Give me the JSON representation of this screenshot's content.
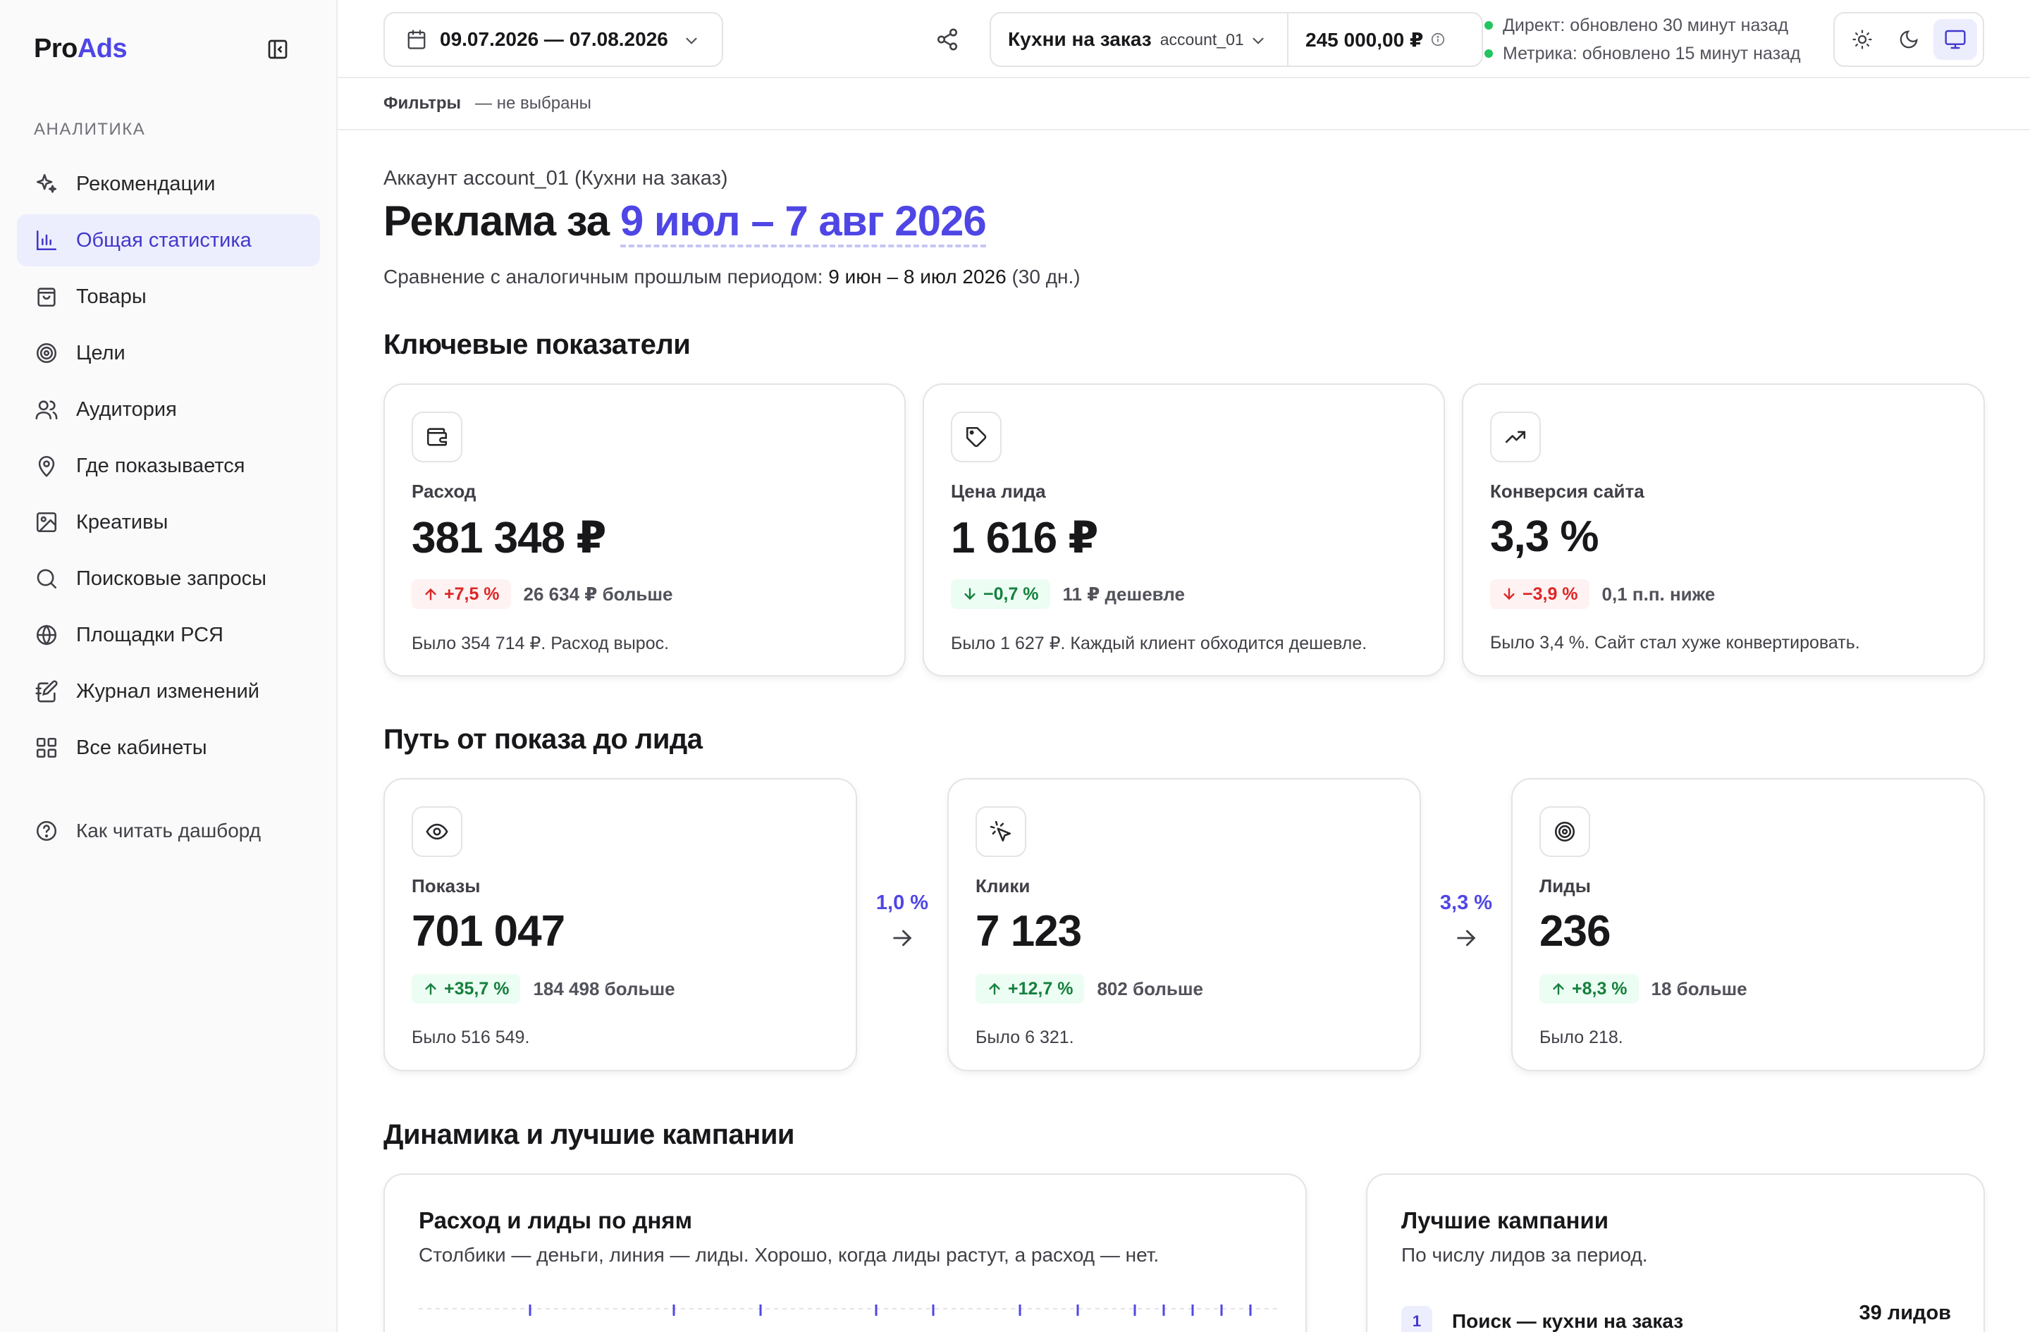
{
  "brand": {
    "pro": "Pro",
    "ads": "Ads"
  },
  "sidebar": {
    "section": "АНАЛИТИКА",
    "items": [
      {
        "label": "Рекомендации",
        "icon": "sparkles-icon"
      },
      {
        "label": "Общая статистика",
        "icon": "bar-chart-icon",
        "active": true
      },
      {
        "label": "Товары",
        "icon": "shopping-bag-icon"
      },
      {
        "label": "Цели",
        "icon": "target-icon"
      },
      {
        "label": "Аудитория",
        "icon": "users-icon"
      },
      {
        "label": "Где показывается",
        "icon": "map-pin-icon"
      },
      {
        "label": "Креативы",
        "icon": "image-icon"
      },
      {
        "label": "Поисковые запросы",
        "icon": "search-icon"
      },
      {
        "label": "Площадки РСЯ",
        "icon": "globe-icon"
      },
      {
        "label": "Журнал изменений",
        "icon": "notebook-pen-icon"
      },
      {
        "label": "Все кабинеты",
        "icon": "grid-icon"
      }
    ],
    "help": "Как читать дашборд"
  },
  "topbar": {
    "date_range": "09.07.2026 — 07.08.2026",
    "account_name": "Кухни на заказ",
    "account_id": "account_01",
    "balance": "245 000,00 ₽",
    "status": [
      "Директ: обновлено 30 минут назад",
      "Метрика: обновлено 15 минут назад"
    ]
  },
  "filters": {
    "label": "Фильтры",
    "value": "— не выбраны"
  },
  "header": {
    "account_caption": "Аккаунт account_01 (Кухни на заказ)",
    "title_prefix": "Реклама за ",
    "title_range": "9 июл – 7 авг 2026",
    "compare_prefix": "Сравнение с аналогичным прошлым периодом: ",
    "compare_range": "9 июн – 8 июл 2026",
    "compare_days": " (30 дн.)"
  },
  "sections": {
    "kpi": "Ключевые показатели",
    "funnel": "Путь от показа до лида",
    "dynamics": "Динамика и лучшие кампании"
  },
  "kpis": [
    {
      "label": "Расход",
      "value": "381 348 ₽",
      "pct": "+7,5 %",
      "tone": "bad",
      "dir": "up",
      "delta": "26 634 ₽ больше",
      "note": "Было 354 714 ₽. Расход вырос."
    },
    {
      "label": "Цена лида",
      "value": "1 616 ₽",
      "pct": "−0,7 %",
      "tone": "good",
      "dir": "down",
      "delta": "11 ₽ дешевле",
      "note": "Было 1 627 ₽. Каждый клиент обходится дешевле."
    },
    {
      "label": "Конверсия сайта",
      "value": "3,3 %",
      "pct": "−3,9 %",
      "tone": "bad",
      "dir": "down",
      "delta": "0,1 п.п. ниже",
      "note": "Было 3,4 %. Сайт стал хуже конвертировать."
    }
  ],
  "funnel": [
    {
      "label": "Показы",
      "value": "701 047",
      "pct": "+35,7 %",
      "delta": "184 498 больше",
      "note": "Было 516 549."
    },
    {
      "label": "Клики",
      "value": "7 123",
      "pct": "+12,7 %",
      "delta": "802 больше",
      "note": "Было 6 321."
    },
    {
      "label": "Лиды",
      "value": "236",
      "pct": "+8,3 %",
      "delta": "18 больше",
      "note": "Было 218."
    }
  ],
  "funnel_rates": [
    "1,0 %",
    "3,3 %"
  ],
  "daily_chart": {
    "title": "Расход и лиды по дням",
    "subtitle": "Столбики — деньги, линия — лиды. Хорошо, когда лиды растут, а расход — нет."
  },
  "campaigns": {
    "title": "Лучшие кампании",
    "subtitle": "По числу лидов за период.",
    "rows": [
      {
        "rank": "1",
        "name": "Поиск — кухни на заказ",
        "leads": "39 лидов"
      }
    ]
  },
  "colors": {
    "accent": "#4f46e5",
    "positive": "#15803d",
    "negative": "#dc2626",
    "status_dot": "#22c55e"
  }
}
